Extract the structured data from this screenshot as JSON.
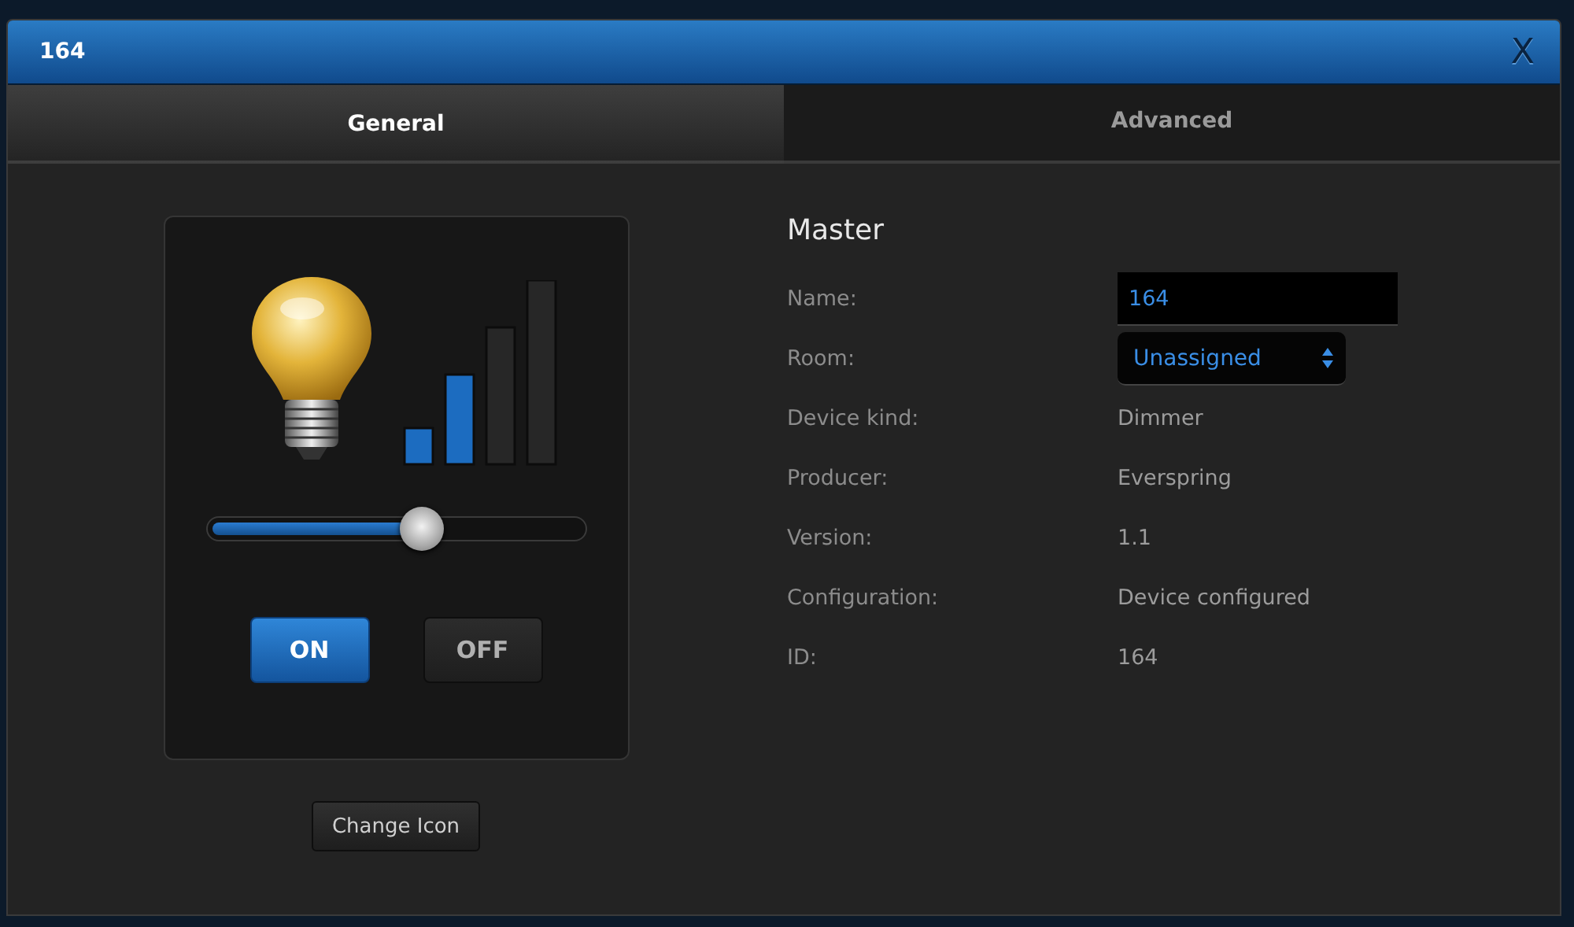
{
  "window": {
    "title": "164",
    "close": "X"
  },
  "tabs": [
    {
      "label": "General",
      "selected": true
    },
    {
      "label": "Advanced",
      "selected": false
    }
  ],
  "device": {
    "meter": {
      "level": 0.5
    },
    "slider": {
      "level": 0.57
    },
    "power_buttons": [
      {
        "label": "ON",
        "selected": true
      },
      {
        "label": "OFF",
        "selected": false
      }
    ],
    "change_icon": "Change Icon"
  },
  "details": {
    "heading": "Master",
    "rows": [
      {
        "kind": "input",
        "label": "Name:",
        "value": "164"
      },
      {
        "kind": "select",
        "label": "Room:",
        "value": "Unassigned"
      },
      {
        "kind": "text",
        "label": "Device kind:",
        "value": "Dimmer"
      },
      {
        "kind": "text",
        "label": "Producer:",
        "value": "Everspring"
      },
      {
        "kind": "text",
        "label": "Version:",
        "value": "1.1"
      },
      {
        "kind": "text",
        "label": "Configuration:",
        "value": "Device configured"
      },
      {
        "kind": "text",
        "label": "ID:",
        "value": "164"
      }
    ]
  }
}
